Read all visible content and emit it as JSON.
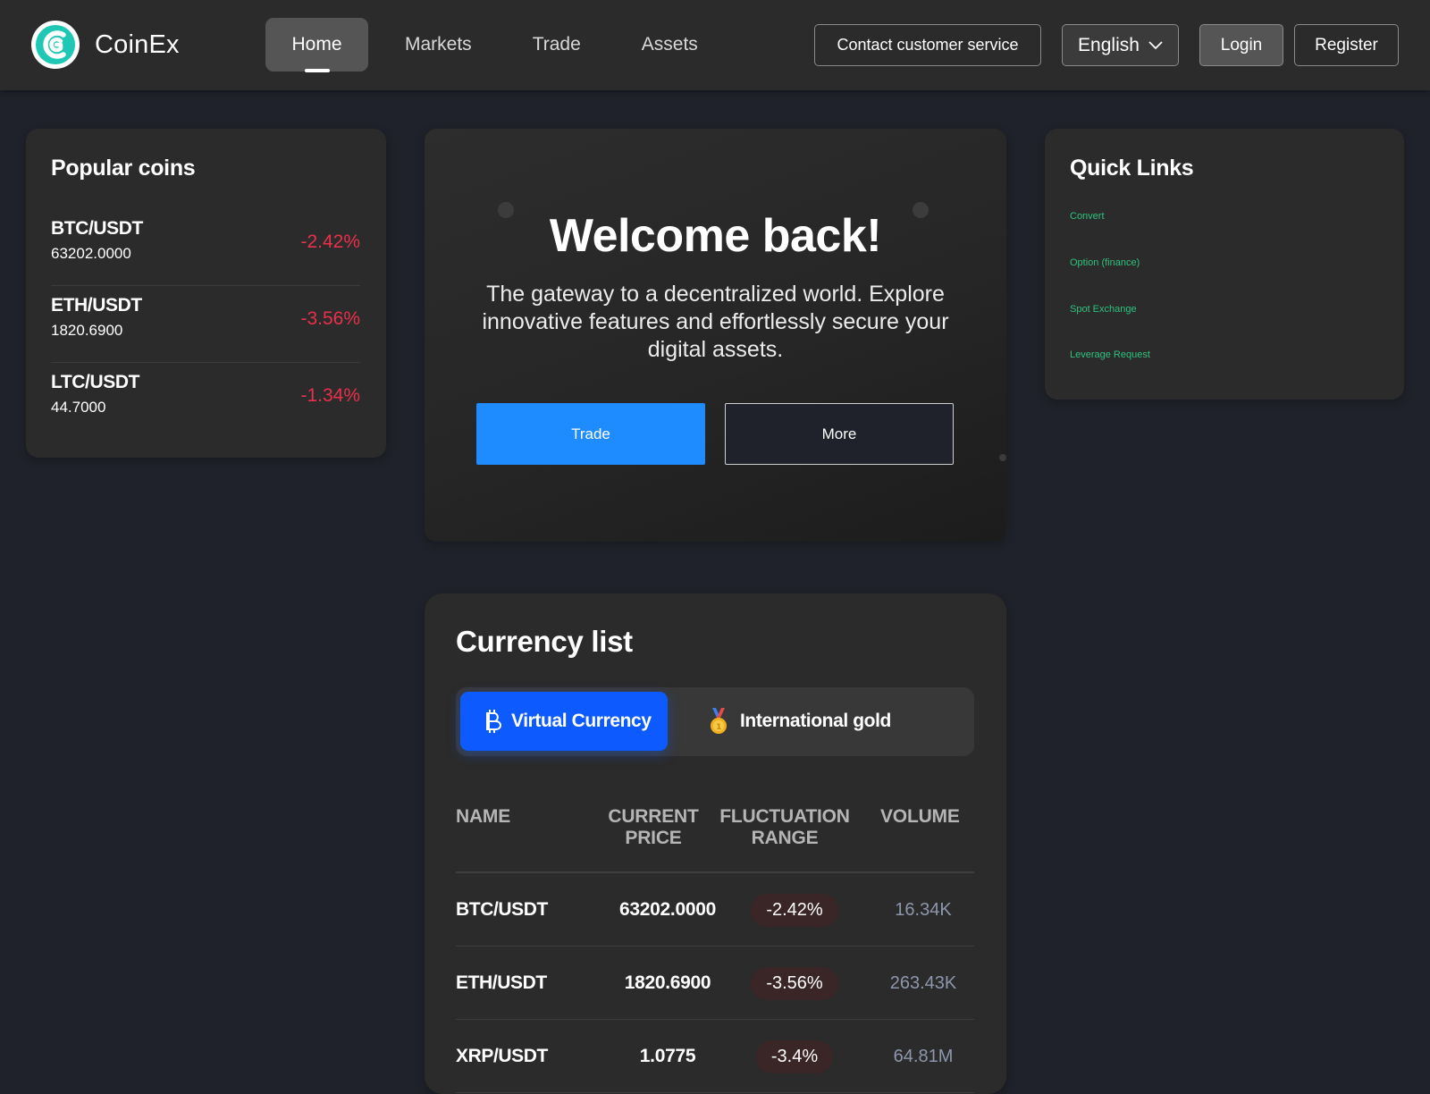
{
  "app": {
    "brand": "CoinEx"
  },
  "nav": {
    "items": [
      "Home",
      "Markets",
      "Trade",
      "Assets"
    ]
  },
  "header": {
    "contact_label": "Contact customer service",
    "language": "English",
    "login_label": "Login",
    "register_label": "Register"
  },
  "popular": {
    "title": "Popular coins",
    "coins": [
      {
        "pair": "BTC/USDT",
        "price": "63202.0000",
        "change": "-2.42%"
      },
      {
        "pair": "ETH/USDT",
        "price": "1820.6900",
        "change": "-3.56%"
      },
      {
        "pair": "LTC/USDT",
        "price": "44.7000",
        "change": "-1.34%"
      }
    ]
  },
  "hero": {
    "title": "Welcome back!",
    "subtitle": "The gateway to a decentralized world. Explore innovative features and effortlessly secure your digital assets.",
    "trade_label": "Trade",
    "more_label": "More"
  },
  "quick_links": {
    "title": "Quick Links",
    "items": [
      "Convert",
      "Option (finance)",
      "Spot Exchange",
      "Leverage Request"
    ]
  },
  "currency": {
    "title": "Currency list",
    "tabs": [
      {
        "label": "Virtual Currency",
        "icon": "bitcoin-icon"
      },
      {
        "label": "International gold",
        "icon": "medal-icon"
      }
    ],
    "columns": [
      "NAME",
      "CURRENT PRICE",
      "FLUCTUATION RANGE",
      "VOLUME"
    ],
    "rows": [
      {
        "name": "BTC/USDT",
        "price": "63202.0000",
        "range": "-2.42%",
        "volume": "16.34K"
      },
      {
        "name": "ETH/USDT",
        "price": "1820.6900",
        "range": "-3.56%",
        "volume": "263.43K"
      },
      {
        "name": "XRP/USDT",
        "price": "1.0775",
        "range": "-3.4%",
        "volume": "64.81M"
      }
    ]
  },
  "colors": {
    "background": "#1f222a",
    "card": "#2b2b2b",
    "accent_blue": "#1e8bff",
    "tab_blue": "#0d5bff",
    "negative": "#e8304d",
    "link_green": "#2ec27e",
    "logo_teal": "#1ec8b4"
  }
}
